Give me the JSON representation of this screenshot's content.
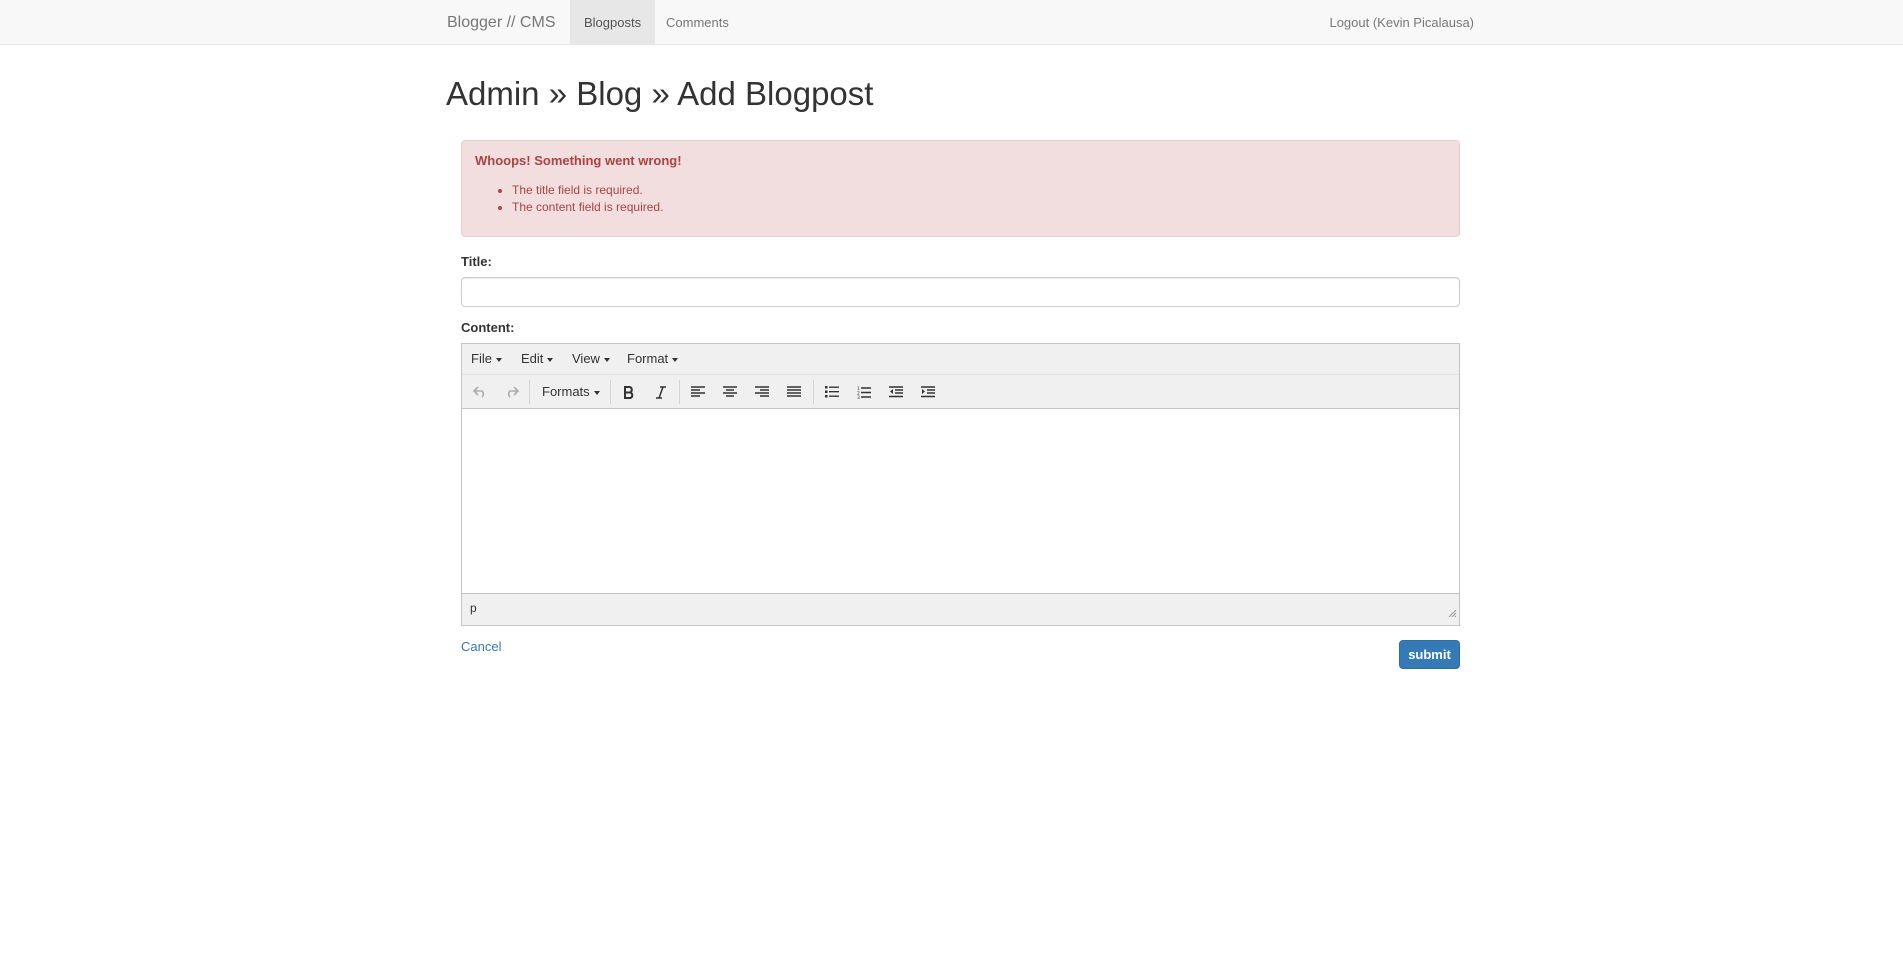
{
  "navbar": {
    "brand": "Blogger // CMS",
    "items": [
      {
        "label": "Blogposts",
        "active": true
      },
      {
        "label": "Comments",
        "active": false
      }
    ],
    "logout": "Logout (Kevin Picalausa)"
  },
  "page": {
    "title": "Admin » Blog » Add Blogpost"
  },
  "alert": {
    "heading": "Whoops! Something went wrong!",
    "errors": [
      "The title field is required.",
      "The content field is required."
    ]
  },
  "form": {
    "title_label": "Title:",
    "title_value": "",
    "content_label": "Content:",
    "cancel": "Cancel",
    "submit": "submit"
  },
  "editor": {
    "menus": [
      "File",
      "Edit",
      "View",
      "Format"
    ],
    "formats_label": "Formats",
    "toolbar_icons": [
      "undo-icon",
      "redo-icon",
      "bold-icon",
      "italic-icon",
      "align-left-icon",
      "align-center-icon",
      "align-right-icon",
      "align-justify-icon",
      "bullet-list-icon",
      "numbered-list-icon",
      "outdent-icon",
      "indent-icon"
    ],
    "status_path": "p"
  },
  "colors": {
    "alert_bg": "#f2dede",
    "alert_text": "#a94442",
    "primary": "#337ab7",
    "navbar_bg": "#f8f8f8"
  }
}
